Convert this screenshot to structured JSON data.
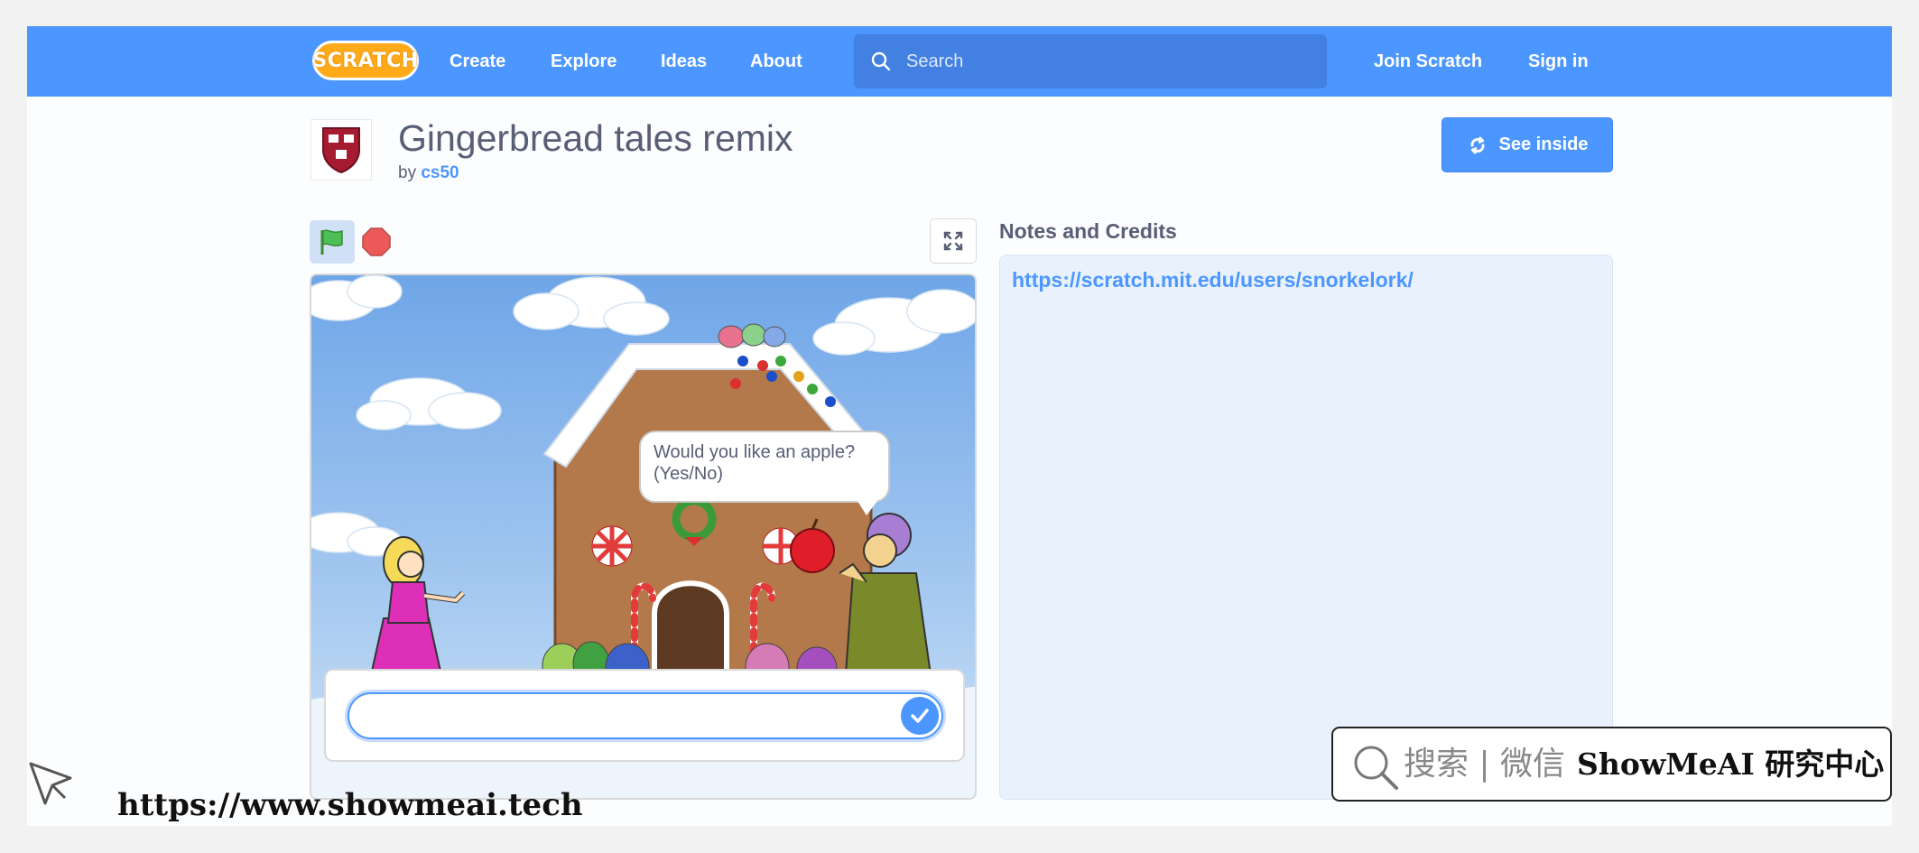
{
  "nav": {
    "logo_text": "SCRATCH",
    "links": [
      "Create",
      "Explore",
      "Ideas",
      "About"
    ],
    "search_placeholder": "Search",
    "join": "Join Scratch",
    "sign_in": "Sign in"
  },
  "project": {
    "title": "Gingerbread tales remix",
    "by_label": "by",
    "author": "cs50",
    "see_inside": "See inside"
  },
  "stage": {
    "speech_line1": "Would you like an apple?",
    "speech_line2": "(Yes/No)",
    "answer_value": ""
  },
  "notes": {
    "title": "Notes and Credits",
    "link": "https://scratch.mit.edu/users/snorkelork/"
  },
  "watermark": {
    "search_text": "搜索 | 微信",
    "brand": "ShowMeAI 研究中心",
    "url": "https://www.showmeai.tech"
  },
  "colors": {
    "accent": "#4c97ff",
    "text": "#575e75",
    "notes_bg": "#e9f1fc"
  }
}
